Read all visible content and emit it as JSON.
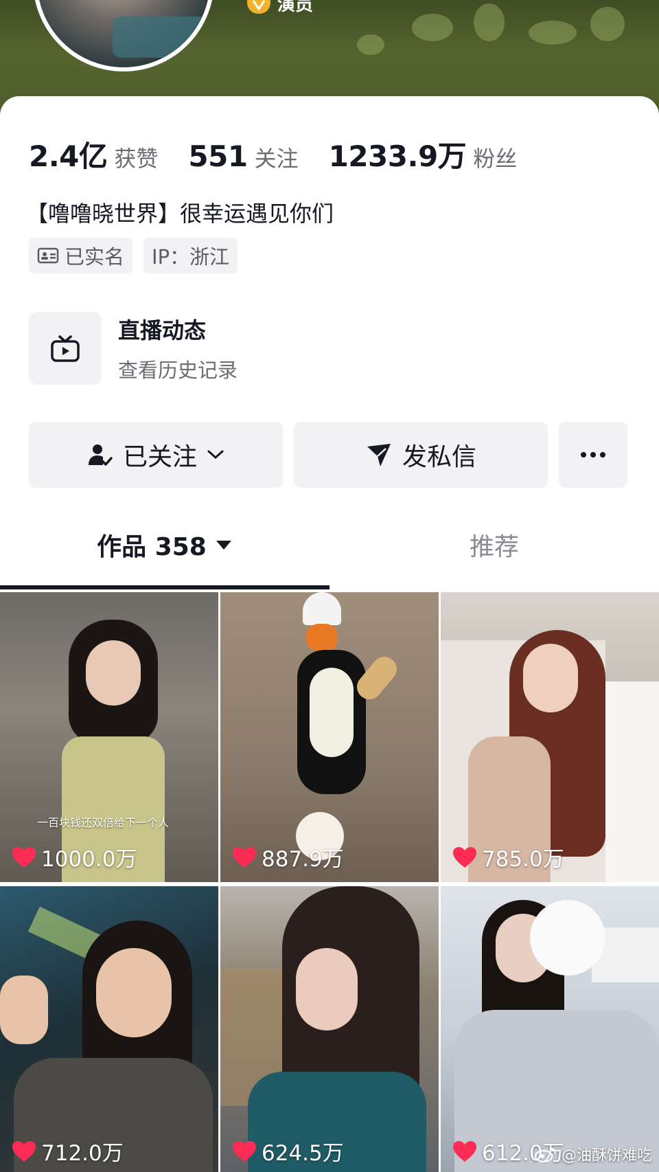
{
  "profile": {
    "role_label": "演员",
    "stats": [
      {
        "value": "2.4亿",
        "label": "获赞"
      },
      {
        "value": "551",
        "label": "关注"
      },
      {
        "value": "1233.9万",
        "label": "粉丝"
      }
    ],
    "bio": "【噜噜晓世界】很幸运遇见你们",
    "tags": {
      "verified": "已实名",
      "ip": "IP：浙江"
    }
  },
  "live_entry": {
    "title": "直播动态",
    "subtitle": "查看历史记录"
  },
  "actions": {
    "follow_label": "已关注",
    "message_label": "发私信"
  },
  "tabs": {
    "works_label": "作品 358",
    "recommend_label": "推荐"
  },
  "videos": [
    {
      "likes": "1000.0万",
      "caption": "一百块钱还双倍给下一个人"
    },
    {
      "likes": "887.9万"
    },
    {
      "likes": "785.0万"
    },
    {
      "likes": "712.0万"
    },
    {
      "likes": "624.5万"
    },
    {
      "likes": "612.0万"
    }
  ],
  "watermark": "@油酥饼难吃",
  "colors": {
    "banner": "#4d5c2a",
    "heart": "#fe2c55",
    "button_bg": "#f2f2f4",
    "badge": "#f2b12b"
  }
}
